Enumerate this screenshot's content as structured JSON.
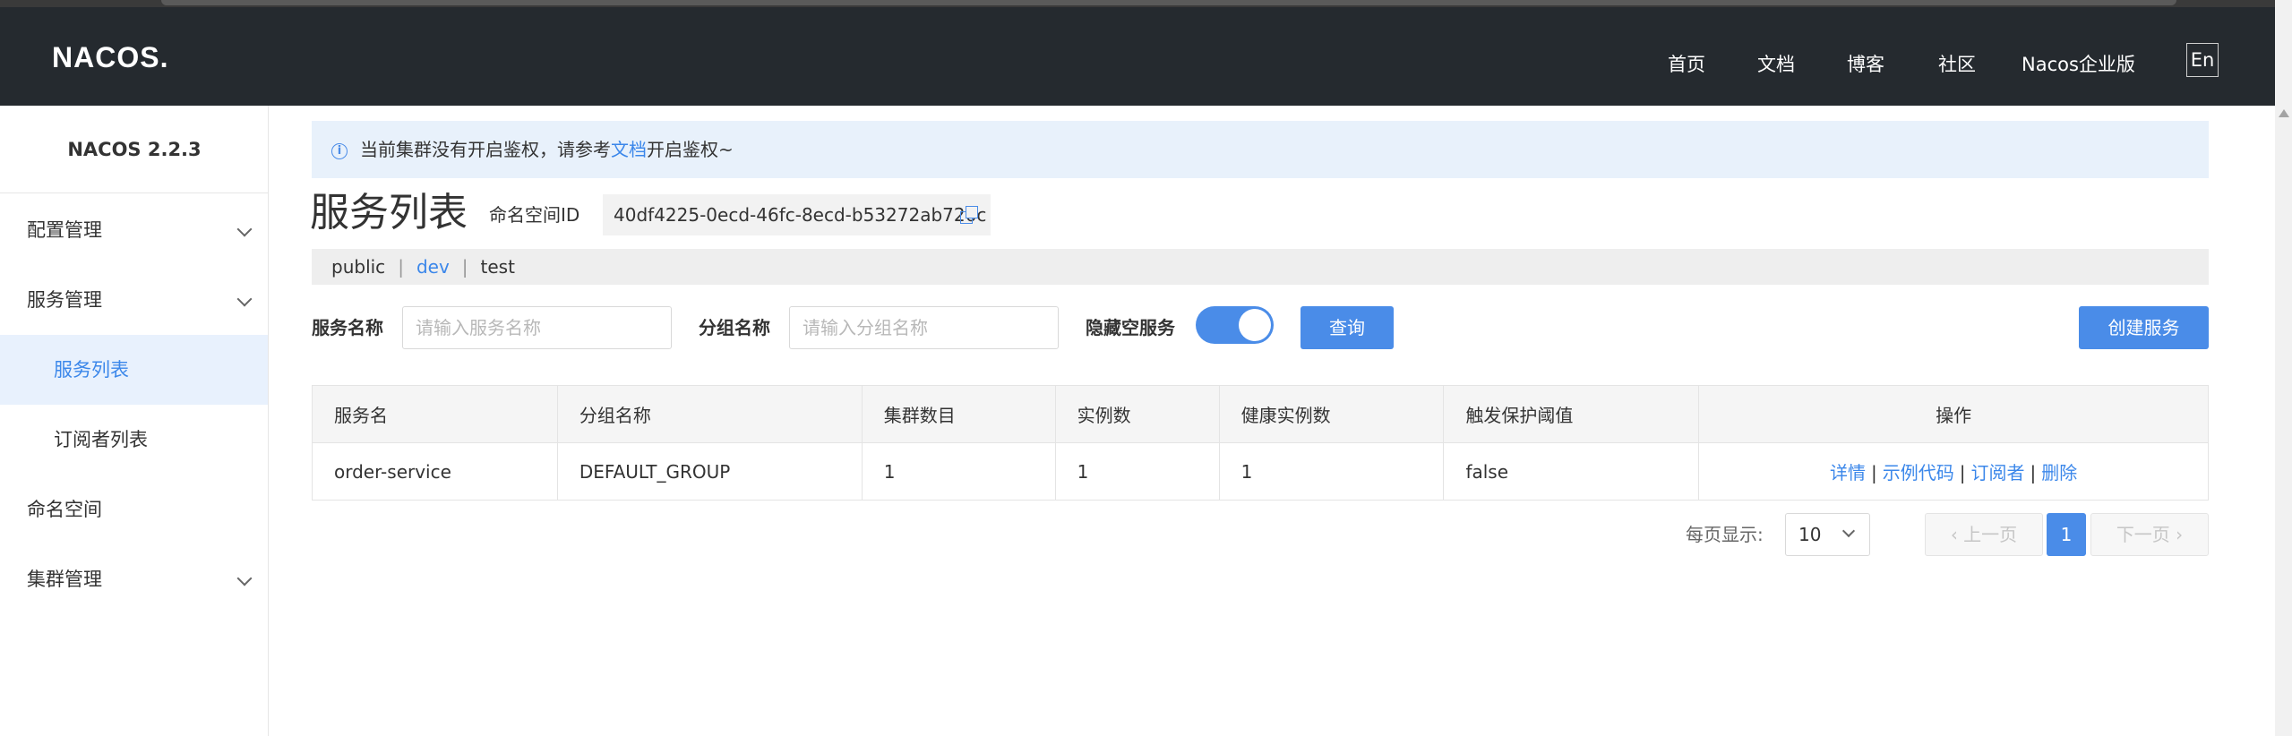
{
  "header": {
    "logo": "NACOS.",
    "nav": [
      "首页",
      "文档",
      "博客",
      "社区",
      "Nacos企业版"
    ],
    "lang": "En"
  },
  "sidebar": {
    "version": "NACOS 2.2.3",
    "items": [
      {
        "label": "配置管理",
        "expandable": true
      },
      {
        "label": "服务管理",
        "expandable": true
      },
      {
        "label": "服务列表",
        "active": true
      },
      {
        "label": "订阅者列表"
      },
      {
        "label": "命名空间"
      },
      {
        "label": "集群管理",
        "expandable": true
      }
    ]
  },
  "notice": {
    "prefix": "当前集群没有开启鉴权，请参考",
    "link": "文档",
    "suffix": "开启鉴权~"
  },
  "page": {
    "title": "服务列表",
    "namespace_label": "命名空间ID",
    "namespace_id": "40df4225-0ecd-46fc-8ecd-b53272ab726c"
  },
  "namespaces": [
    {
      "label": "public"
    },
    {
      "label": "dev",
      "active": true
    },
    {
      "label": "test"
    }
  ],
  "filters": {
    "service_name_label": "服务名称",
    "service_name_placeholder": "请输入服务名称",
    "group_name_label": "分组名称",
    "group_name_placeholder": "请输入分组名称",
    "hide_empty_label": "隐藏空服务",
    "hide_empty_on": true,
    "query_button": "查询",
    "create_button": "创建服务"
  },
  "table": {
    "columns": [
      "服务名",
      "分组名称",
      "集群数目",
      "实例数",
      "健康实例数",
      "触发保护阈值",
      "操作"
    ],
    "rows": [
      {
        "service": "order-service",
        "group": "DEFAULT_GROUP",
        "clusters": "1",
        "instances": "1",
        "healthy": "1",
        "threshold": "false",
        "ops": [
          "详情",
          "示例代码",
          "订阅者",
          "删除"
        ]
      }
    ],
    "op_separator": "|"
  },
  "pagination": {
    "page_size_label": "每页显示:",
    "page_size": "10",
    "prev": "上一页",
    "current": "1",
    "next": "下一页"
  },
  "colors": {
    "header_bg": "#252a2f",
    "accent": "#4a8ce8",
    "link": "#3b87ea",
    "active_bg": "#e8f1fd"
  }
}
